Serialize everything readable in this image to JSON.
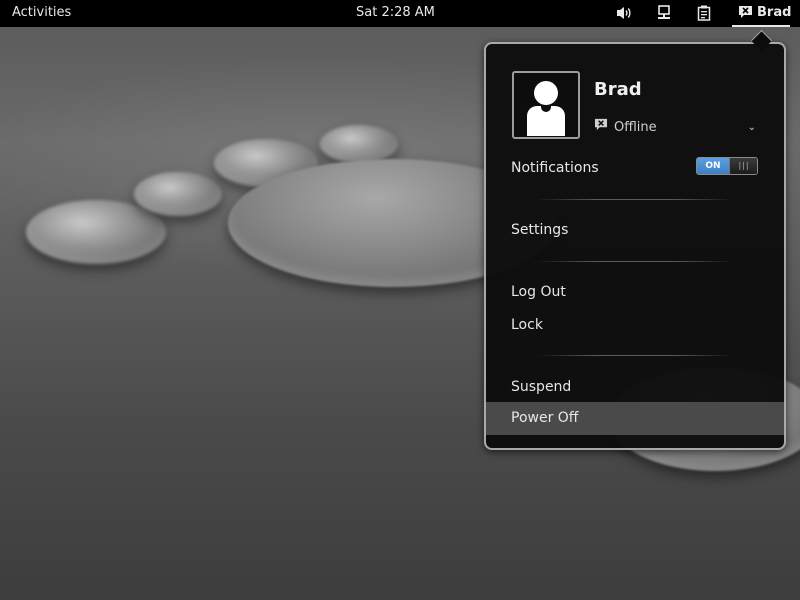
{
  "topbar": {
    "activities": "Activities",
    "clock": "Sat  2:28 AM",
    "icons": [
      "volume-icon",
      "network-icon",
      "clipboard-icon",
      "user-status-icon"
    ],
    "user": "Brad"
  },
  "menu": {
    "user_name": "Brad",
    "status": "Offline",
    "notifications_label": "Notifications",
    "notifications_toggle": {
      "state_label": "ON",
      "on": true
    },
    "items": {
      "settings": "Settings",
      "log_out": "Log Out",
      "lock": "Lock",
      "suspend": "Suspend",
      "power_off": "Power Off"
    },
    "highlighted_item": "Power Off"
  },
  "colors": {
    "topbar_bg": "#000000",
    "menu_bg": "#0c0c0c",
    "menu_border": "#a9a9a9",
    "toggle_on": "#4a8fd6",
    "hover_bg": "#4a4a4a"
  }
}
